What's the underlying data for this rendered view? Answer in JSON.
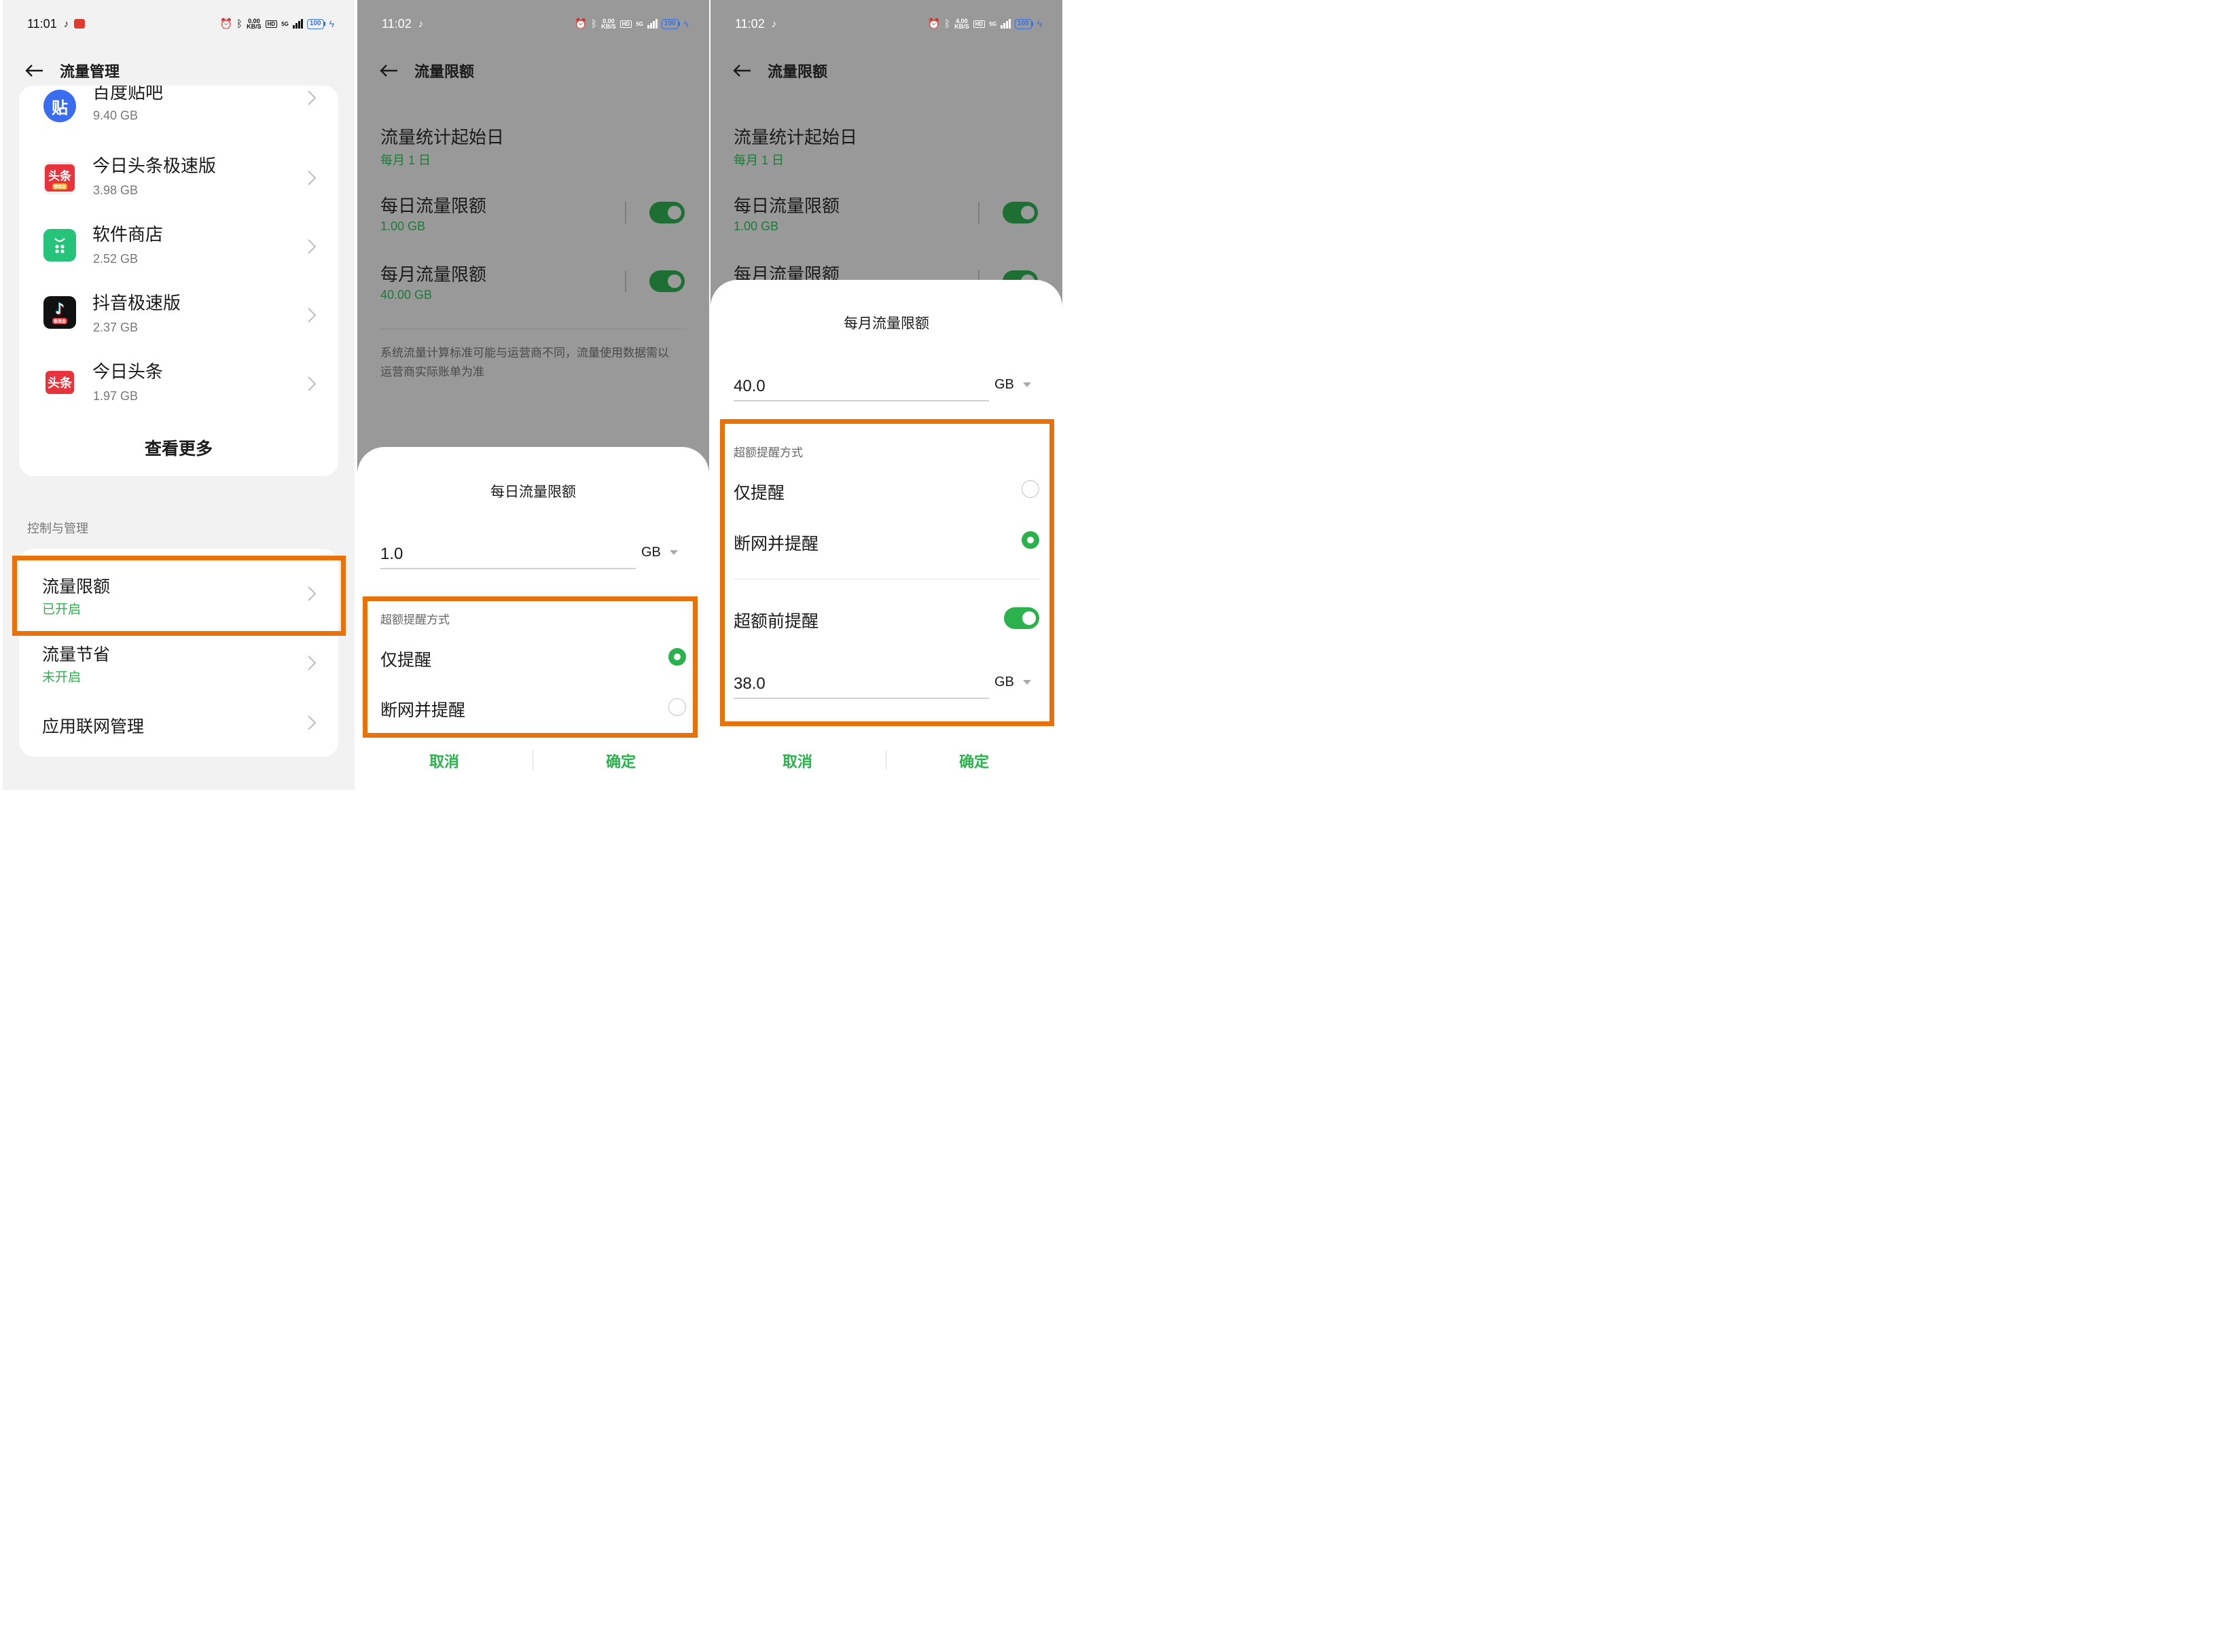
{
  "panel1": {
    "status": {
      "time": "11:01",
      "speed_top": "0.00",
      "speed_bottom": "KB/S",
      "hd": "HD",
      "net": "5G",
      "battery": "100"
    },
    "header_title": "流量管理",
    "apps": [
      {
        "name": "百度贴吧",
        "size": "9.40 GB",
        "icon_text": "贴"
      },
      {
        "name": "今日头条极速版",
        "size": "3.98 GB",
        "icon_text": "头条",
        "icon_sub": "领现金"
      },
      {
        "name": "软件商店",
        "size": "2.52 GB",
        "icon_text": ""
      },
      {
        "name": "抖音极速版",
        "size": "2.37 GB",
        "icon_text": "",
        "icon_sub": "极现金"
      },
      {
        "name": "今日头条",
        "size": "1.97 GB",
        "icon_text": "头条"
      }
    ],
    "see_more": "查看更多",
    "section_label": "控制与管理",
    "controls": [
      {
        "title": "流量限额",
        "status": "已开启"
      },
      {
        "title": "流量节省",
        "status": "未开启"
      },
      {
        "title": "应用联网管理",
        "status": ""
      }
    ]
  },
  "panel2": {
    "status": {
      "time": "11:02",
      "speed_top": "0.00",
      "speed_bottom": "KB/S",
      "hd": "HD",
      "net": "5G",
      "battery": "100"
    },
    "header_title": "流量限额",
    "start_day": {
      "title": "流量统计起始日",
      "value": "每月 1 日"
    },
    "daily": {
      "title": "每日流量限额",
      "value": "1.00 GB"
    },
    "monthly": {
      "title": "每月流量限额",
      "value": "40.00 GB"
    },
    "note": "系统流量计算标准可能与运营商不同，流量使用数据需以运营商实际账单为准",
    "sheet": {
      "title": "每日流量限额",
      "amount": "1.0",
      "unit": "GB",
      "mode_label": "超额提醒方式",
      "options": [
        {
          "label": "仅提醒",
          "selected": true
        },
        {
          "label": "断网并提醒",
          "selected": false
        }
      ],
      "cancel": "取消",
      "confirm": "确定"
    }
  },
  "panel3": {
    "status": {
      "time": "11:02",
      "speed_top": "4.00",
      "speed_bottom": "KB/S",
      "hd": "HD",
      "net": "5G",
      "battery": "100"
    },
    "header_title": "流量限额",
    "start_day": {
      "title": "流量统计起始日",
      "value": "每月 1 日"
    },
    "daily": {
      "title": "每日流量限额",
      "value": "1.00 GB"
    },
    "monthly": {
      "title": "每月流量限额"
    },
    "sheet": {
      "title": "每月流量限额",
      "amount": "40.0",
      "unit": "GB",
      "mode_label": "超额提醒方式",
      "options": [
        {
          "label": "仅提醒",
          "selected": false
        },
        {
          "label": "断网并提醒",
          "selected": true
        }
      ],
      "pre_alert": {
        "label": "超额前提醒",
        "enabled": true,
        "amount": "38.0",
        "unit": "GB"
      },
      "cancel": "取消",
      "confirm": "确定"
    }
  },
  "colors": {
    "accent": "#2bb24c",
    "highlight": "#e8710a",
    "dim_bg": "#999999"
  },
  "icons": {
    "back": "back-arrow-icon",
    "chevron": "chevron-right-icon",
    "alarm": "alarm-icon",
    "bluetooth": "bluetooth-icon",
    "music": "tiktok-note-icon"
  }
}
